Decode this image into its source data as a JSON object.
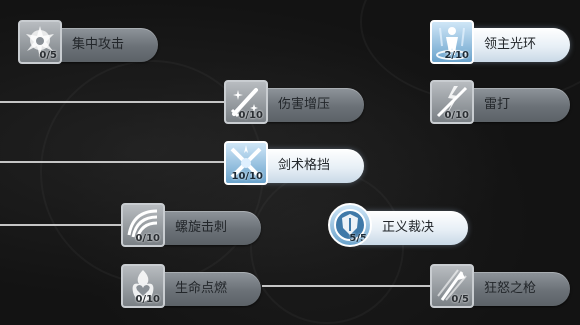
{
  "skills": [
    {
      "id": "focus-strike",
      "name": "集中攻击",
      "level": "0/5",
      "active": false,
      "icon": "burst-icon"
    },
    {
      "id": "lord-aura",
      "name": "领主光环",
      "level": "2/10",
      "active": true,
      "icon": "aura-figure-icon"
    },
    {
      "id": "damage-boost",
      "name": "伤害增压",
      "level": "0/10",
      "active": false,
      "icon": "sparkle-sword-icon"
    },
    {
      "id": "lightning-strike",
      "name": "雷打",
      "level": "0/10",
      "active": false,
      "icon": "lightning-slash-icon"
    },
    {
      "id": "sword-parry",
      "name": "剑术格挡",
      "level": "10/10",
      "active": true,
      "icon": "crossed-swords-icon"
    },
    {
      "id": "spiral-thrust",
      "name": "螺旋击刺",
      "level": "0/10",
      "active": false,
      "icon": "spiral-wing-icon"
    },
    {
      "id": "righteous-judgment",
      "name": "正义裁决",
      "level": "5/5",
      "active": true,
      "icon": "shield-orb-icon"
    },
    {
      "id": "life-ignite",
      "name": "生命点燃",
      "level": "0/10",
      "active": false,
      "icon": "flame-heart-icon"
    },
    {
      "id": "fury-spear",
      "name": "狂怒之枪",
      "level": "0/5",
      "active": false,
      "icon": "spear-icon"
    }
  ],
  "colors": {
    "background": "#131313",
    "pill_inactive": "#6b7177",
    "pill_active": "#e7eff6",
    "icon_active": "#6aa3cc",
    "connector": "#d8d8d8"
  }
}
